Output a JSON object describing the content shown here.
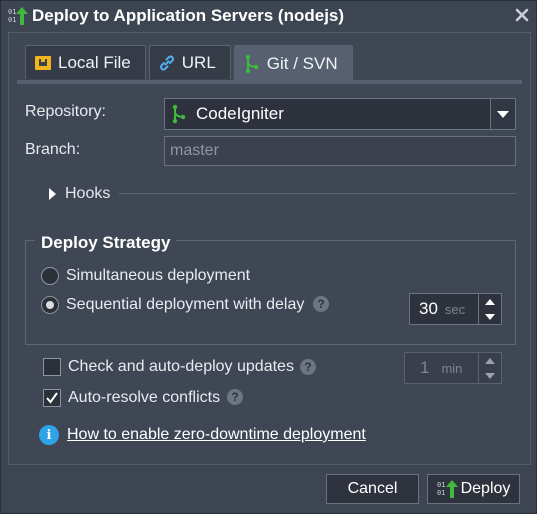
{
  "window": {
    "title": "Deploy to Application Servers (nodejs)"
  },
  "tabs": [
    {
      "label": "Local File",
      "icon": "archive-icon",
      "active": false
    },
    {
      "label": "URL",
      "icon": "link-icon",
      "active": false
    },
    {
      "label": "Git / SVN",
      "icon": "git-icon",
      "active": true
    }
  ],
  "form": {
    "repository_label": "Repository:",
    "repository_value": "CodeIgniter",
    "branch_label": "Branch:",
    "branch_value": "master"
  },
  "hooks": {
    "label": "Hooks"
  },
  "strategy": {
    "legend": "Deploy Strategy",
    "option_simultaneous": "Simultaneous deployment",
    "option_sequential": "Sequential deployment with delay",
    "selected": "sequential",
    "delay_value": "30",
    "delay_unit": "sec"
  },
  "options": {
    "auto_deploy_label": "Check and auto-deploy updates",
    "auto_deploy_checked": false,
    "interval_value": "1",
    "interval_unit": "min",
    "auto_resolve_label": "Auto-resolve conflicts",
    "auto_resolve_checked": true
  },
  "help_link": "How to enable zero-downtime deployment",
  "help_mark": "?",
  "info_mark": "i",
  "buttons": {
    "cancel": "Cancel",
    "deploy": "Deploy"
  },
  "colors": {
    "background": "#3d4452",
    "git_green": "#3fba3f",
    "info_blue": "#2fa3e8",
    "archive_yellow": "#f3b61f"
  }
}
